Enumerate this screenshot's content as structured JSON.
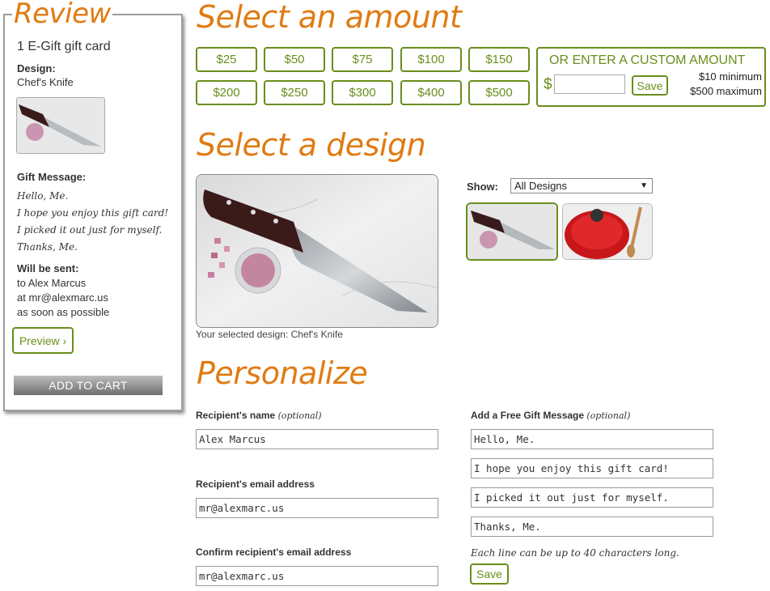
{
  "review": {
    "legend": "Review",
    "item": "1 E-Gift gift card",
    "design_label": "Design:",
    "design_value": "Chef's Knife",
    "gift_message_label": "Gift Message:",
    "message_lines": [
      "Hello, Me.",
      "I hope you enjoy this gift card!",
      "I picked it out just for myself.",
      "Thanks, Me."
    ],
    "will_be_sent_label": "Will be sent:",
    "sent_to": "to Alex Marcus",
    "sent_at": "at mr@alexmarc.us",
    "sent_when": "as soon as possible",
    "preview_label": "Preview ›",
    "add_to_cart_label": "ADD TO CART"
  },
  "amount": {
    "heading": "Select an amount",
    "options": [
      "$25",
      "$50",
      "$75",
      "$100",
      "$150",
      "$200",
      "$250",
      "$300",
      "$400",
      "$500"
    ],
    "custom": {
      "title": "OR ENTER A CUSTOM AMOUNT",
      "currency": "$",
      "value": "",
      "save_label": "Save",
      "minimum": "$10 minimum",
      "maximum": "$500 maximum"
    }
  },
  "design": {
    "heading": "Select a design",
    "caption": "Your selected design: Chef's Knife",
    "show_label": "Show:",
    "filter_value": "All Designs",
    "thumbnails": [
      {
        "name": "chef-knife",
        "selected": true
      },
      {
        "name": "red-dutch-oven",
        "selected": false
      }
    ]
  },
  "personalize": {
    "heading": "Personalize",
    "recipient_name_label": "Recipient's name",
    "recipient_name_optional": "(optional)",
    "recipient_name_value": "Alex Marcus",
    "recipient_email_label": "Recipient's email address",
    "recipient_email_value": "mr@alexmarc.us",
    "confirm_email_label": "Confirm recipient's email address",
    "confirm_email_value": "mr@alexmarc.us",
    "message_label": "Add a Free Gift Message",
    "message_optional": "(optional)",
    "message_lines": [
      "Hello, Me.",
      "I hope you enjoy this gift card!",
      "I picked it out just for myself.",
      "Thanks, Me."
    ],
    "hint": "Each line can be up to 40 characters long.",
    "save_label": "Save"
  },
  "colors": {
    "accent_orange": "#e07b12",
    "accent_green": "#6a8e1c"
  }
}
